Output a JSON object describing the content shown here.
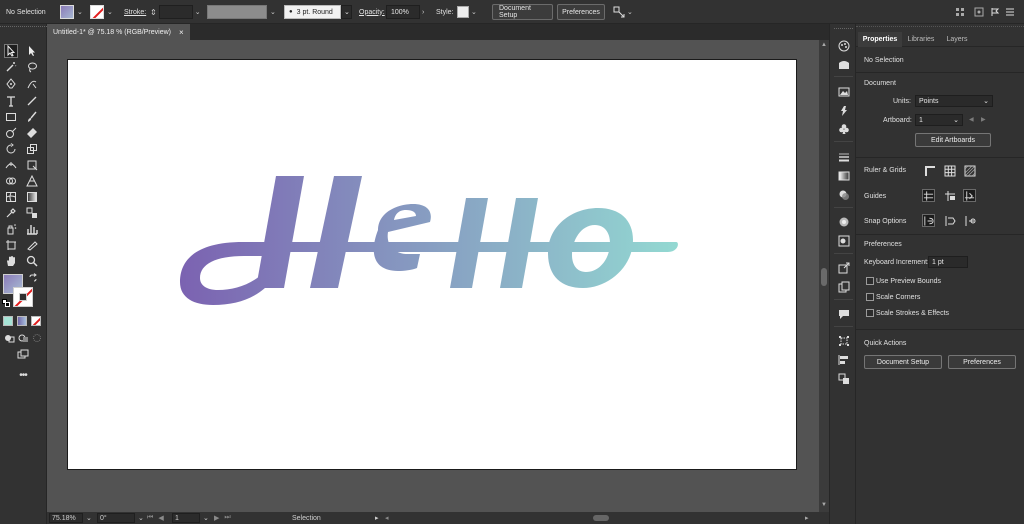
{
  "control_bar": {
    "selection_label": "No Selection",
    "stroke_label": "Stroke:",
    "brush_label": "3 pt. Round",
    "opacity_label": "Opacity:",
    "opacity_value": "100%",
    "style_label": "Style:",
    "document_setup_label": "Document Setup",
    "preferences_label": "Preferences"
  },
  "document_tab": {
    "title": "Untitled-1* @ 75.18 % (RGB/Preview)",
    "close": "×"
  },
  "artwork": {
    "text": "Hello",
    "gradient_start": "#7b62b1",
    "gradient_end": "#93d9d2"
  },
  "status_bar": {
    "zoom": "75.18%",
    "rotation": "0°",
    "artboard_number": "1",
    "status_text": "Selection"
  },
  "panel": {
    "tabs": [
      "Properties",
      "Libraries",
      "Layers"
    ],
    "selection_state": "No Selection",
    "document_heading": "Document",
    "units_label": "Units:",
    "units_value": "Points",
    "artboard_label": "Artboard:",
    "artboard_value": "1",
    "edit_artboards_label": "Edit Artboards",
    "ruler_grids_label": "Ruler & Grids",
    "guides_label": "Guides",
    "snap_options_label": "Snap Options",
    "preferences_heading": "Preferences",
    "keyboard_increment_label": "Keyboard Increment:",
    "keyboard_increment_value": "1 pt",
    "checkboxes": [
      "Use Preview Bounds",
      "Scale Corners",
      "Scale Strokes & Effects"
    ],
    "quick_actions_heading": "Quick Actions",
    "qa_document_setup_label": "Document Setup",
    "qa_preferences_label": "Preferences"
  },
  "colors": {
    "accent_stroke_none": "#e31e1e",
    "panel_bg": "#323232",
    "canvas_bg": "#535353"
  }
}
